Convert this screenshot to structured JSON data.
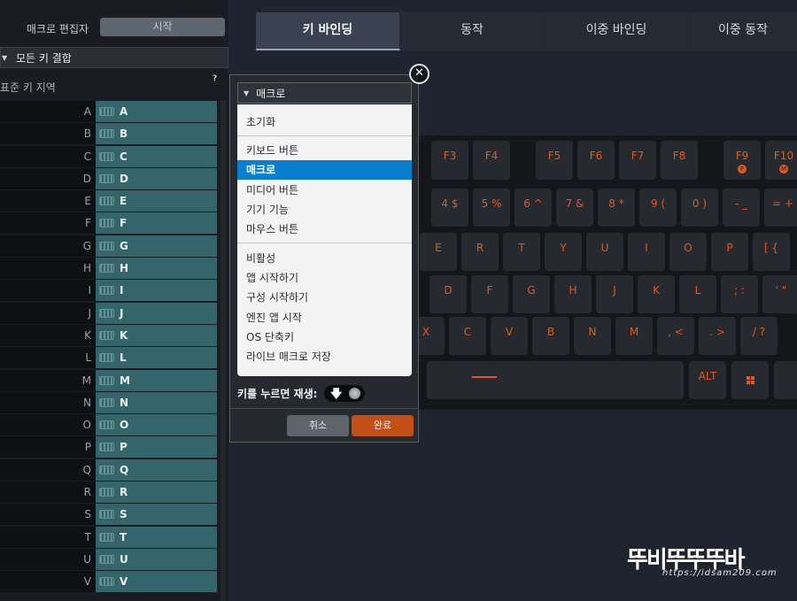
{
  "left_panel": {
    "editor_label": "매크로 편집자",
    "start_button": "시작",
    "combo_value": "모든 키 결합",
    "section_label": "표준 키 지역",
    "help": "?",
    "rows": [
      {
        "key": "A",
        "value": "A"
      },
      {
        "key": "B",
        "value": "B"
      },
      {
        "key": "C",
        "value": "C"
      },
      {
        "key": "D",
        "value": "D"
      },
      {
        "key": "E",
        "value": "E"
      },
      {
        "key": "F",
        "value": "F"
      },
      {
        "key": "G",
        "value": "G"
      },
      {
        "key": "H",
        "value": "H"
      },
      {
        "key": "I",
        "value": "I"
      },
      {
        "key": "J",
        "value": "J"
      },
      {
        "key": "K",
        "value": "K"
      },
      {
        "key": "L",
        "value": "L"
      },
      {
        "key": "M",
        "value": "M"
      },
      {
        "key": "N",
        "value": "N"
      },
      {
        "key": "O",
        "value": "O"
      },
      {
        "key": "P",
        "value": "P"
      },
      {
        "key": "Q",
        "value": "Q"
      },
      {
        "key": "R",
        "value": "R"
      },
      {
        "key": "S",
        "value": "S"
      },
      {
        "key": "T",
        "value": "T"
      },
      {
        "key": "U",
        "value": "U"
      },
      {
        "key": "V",
        "value": "V"
      }
    ]
  },
  "tabs": [
    "키 바인딩",
    "동작",
    "이중 바인딩",
    "이중 동작"
  ],
  "active_tab": 0,
  "keyboard": {
    "accent_color": "#e3581f",
    "row_fn": [
      "F3",
      "F4",
      "F5",
      "F6",
      "F7",
      "F8",
      "F9",
      "F10"
    ],
    "fn_subs": {
      "F9": "P",
      "F10": "M"
    },
    "row_num": [
      "4 $",
      "5 %",
      "6 ^",
      "7 &",
      "8 *",
      "9 (",
      "0 )",
      "- _",
      "= +"
    ],
    "row_q": [
      "E",
      "R",
      "T",
      "Y",
      "U",
      "I",
      "O",
      "P",
      "[ {"
    ],
    "row_a": [
      "D",
      "F",
      "G",
      "H",
      "J",
      "K",
      "L",
      "; :",
      "' \""
    ],
    "row_z": [
      "X",
      "C",
      "V",
      "B",
      "N",
      "M",
      ", <",
      ". >",
      "/ ?"
    ],
    "alt": "ALT"
  },
  "popup": {
    "select_value": "매크로",
    "close": "✕",
    "menu": [
      {
        "label": "초기화",
        "group": 1
      },
      {
        "label": "키보드 버튼",
        "group": 2
      },
      {
        "label": "매크로",
        "group": 2,
        "selected": true
      },
      {
        "label": "미디어 버튼",
        "group": 2
      },
      {
        "label": "기기 기능",
        "group": 2
      },
      {
        "label": "마우스 버튼",
        "group": 2
      },
      {
        "label": "비활성",
        "group": 3
      },
      {
        "label": "앱 시작하기",
        "group": 3
      },
      {
        "label": "구성 시작하기",
        "group": 3
      },
      {
        "label": "엔진 앱 시작",
        "group": 3
      },
      {
        "label": "OS 단축키",
        "group": 3
      },
      {
        "label": "라이브 매크로 저장",
        "group": 3
      }
    ],
    "replay_label": "키를 누르면 재생:",
    "cancel": "취소",
    "done": "완료"
  },
  "watermark": {
    "text": "뚜비뚜뚜뚜바",
    "url": "https://idsam209.com"
  }
}
